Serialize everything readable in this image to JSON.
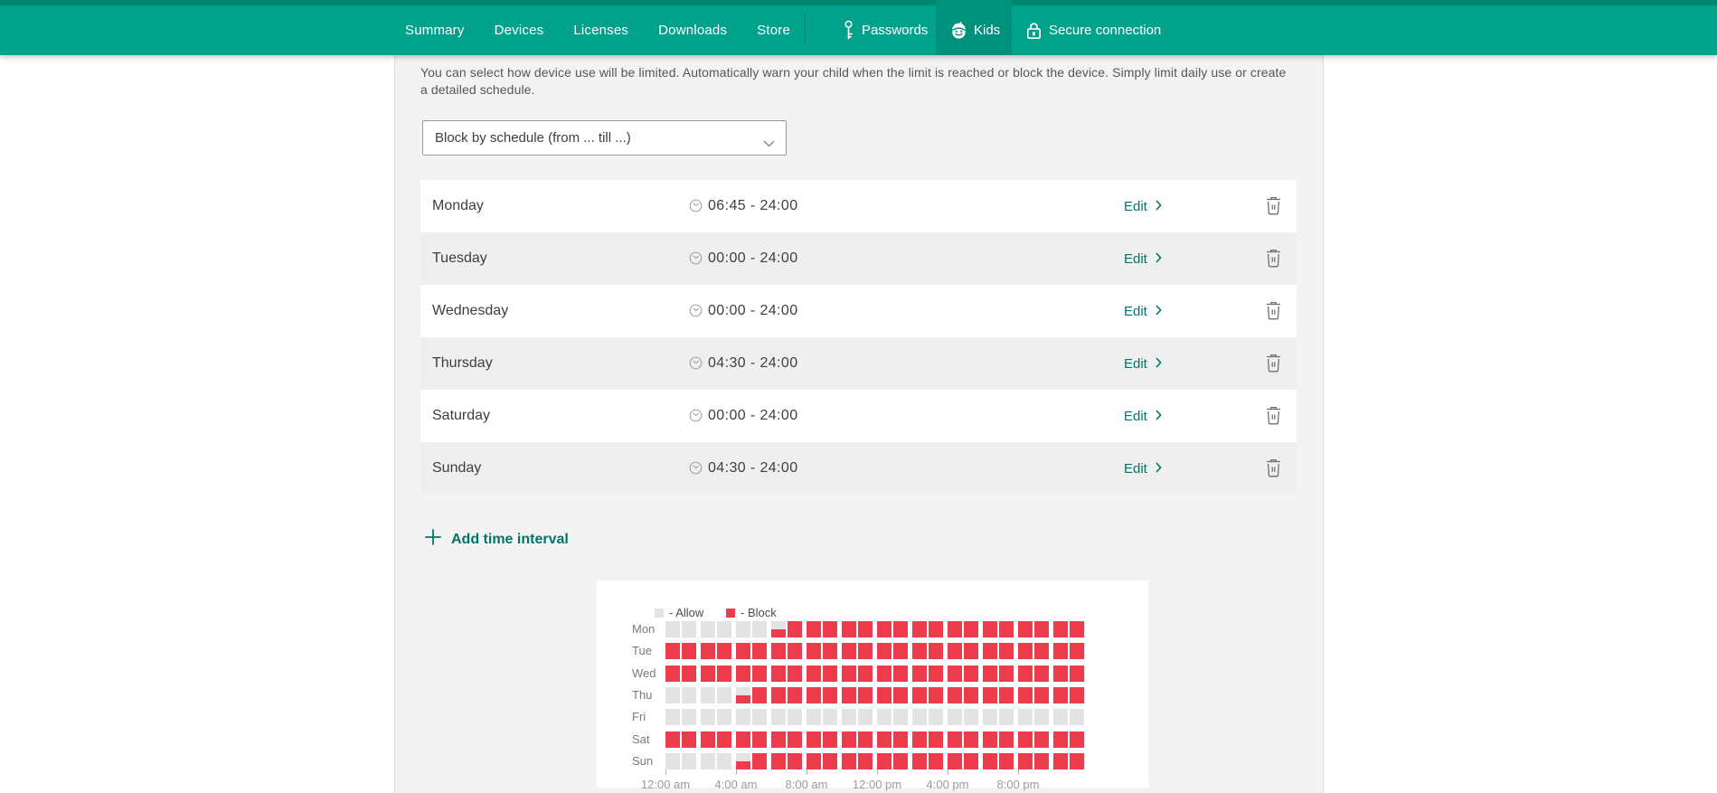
{
  "nav": {
    "tabs": [
      {
        "label": "Summary"
      },
      {
        "label": "Devices"
      },
      {
        "label": "Licenses"
      },
      {
        "label": "Downloads"
      },
      {
        "label": "Store"
      }
    ],
    "passwords": {
      "label": "Passwords",
      "icon": "key-icon"
    },
    "kids": {
      "label": "Kids",
      "icon": "kid-face-icon",
      "active": true
    },
    "secure": {
      "label": "Secure connection",
      "icon": "lock-icon"
    }
  },
  "intro": {
    "line1": "You can select how device use will be limited. Automatically warn your child when the limit is reached or block the device. Simply limit daily use or create",
    "line2": "a detailed schedule."
  },
  "limit_mode_dropdown": {
    "value": "Block by schedule (from ... till ...)",
    "icon": "chevron-down-icon"
  },
  "labels": {
    "edit": "Edit",
    "add_interval": "Add time interval"
  },
  "schedule_rows": [
    {
      "day": "Monday",
      "time": "06:45 - 24:00"
    },
    {
      "day": "Tuesday",
      "time": "00:00 - 24:00"
    },
    {
      "day": "Wednesday",
      "time": "00:00 - 24:00"
    },
    {
      "day": "Thursday",
      "time": "04:30 - 24:00"
    },
    {
      "day": "Saturday",
      "time": "00:00 - 24:00"
    },
    {
      "day": "Sunday",
      "time": "04:30 - 24:00"
    }
  ],
  "chart_data": {
    "type": "heatmap",
    "legend": [
      {
        "label": "- Allow",
        "color": "#e3e3e4"
      },
      {
        "label": "- Block",
        "color": "#ec3b4a"
      }
    ],
    "legend_position": "top-left",
    "days": [
      "Mon",
      "Tue",
      "Wed",
      "Thu",
      "Fri",
      "Sat",
      "Sun"
    ],
    "hours": 24,
    "blocked_intervals": [
      {
        "day": "Mon",
        "from": "06:45",
        "till": "24:00"
      },
      {
        "day": "Tue",
        "from": "00:00",
        "till": "24:00"
      },
      {
        "day": "Wed",
        "from": "00:00",
        "till": "24:00"
      },
      {
        "day": "Thu",
        "from": "04:30",
        "till": "24:00"
      },
      {
        "day": "Sat",
        "from": "00:00",
        "till": "24:00"
      },
      {
        "day": "Sun",
        "from": "04:30",
        "till": "24:00"
      }
    ],
    "cells": [
      "aaaaaapbbbbbbbbbbbbbbbbb",
      "bbbbbbbbbbbbbbbbbbbbbbbb",
      "bbbbbbbbbbbbbbbbbbbbbbbb",
      "aaaapbbbbbbbbbbbbbbbbbbb",
      "aaaaaaaaaaaaaaaaaaaaaaaa",
      "bbbbbbbbbbbbbbbbbbbbbbbb",
      "aaaapbbbbbbbbbbbbbbbbbbb"
    ],
    "partial_fill": 0.5,
    "x_tick_hours": [
      0,
      4,
      8,
      12,
      16,
      20
    ],
    "x_tick_labels": [
      "12:00 am",
      "4:00 am",
      "8:00 am",
      "12:00 pm",
      "4:00 pm",
      "8:00 pm"
    ]
  },
  "colors": {
    "navbar": "#00a28c",
    "navbar_top_strip": "#00876e",
    "active_tab": "#00917c",
    "pane_gray": "#f3f3f4",
    "row_alt_gray": "#efeff0",
    "accent_link": "#00756d",
    "block_red": "#ec3b4a",
    "allow_gray": "#e3e3e4",
    "text_dark": "#3e3e40",
    "text_muted": "#565656"
  },
  "icons": {
    "key-icon": "key",
    "kid-face-icon": "child face with beret",
    "lock-icon": "padlock",
    "clock-icon": "clock",
    "trash-icon": "trash can",
    "plus-icon": "plus",
    "chevron-down-icon": "chevron down",
    "chevron-right-icon": "chevron right"
  }
}
